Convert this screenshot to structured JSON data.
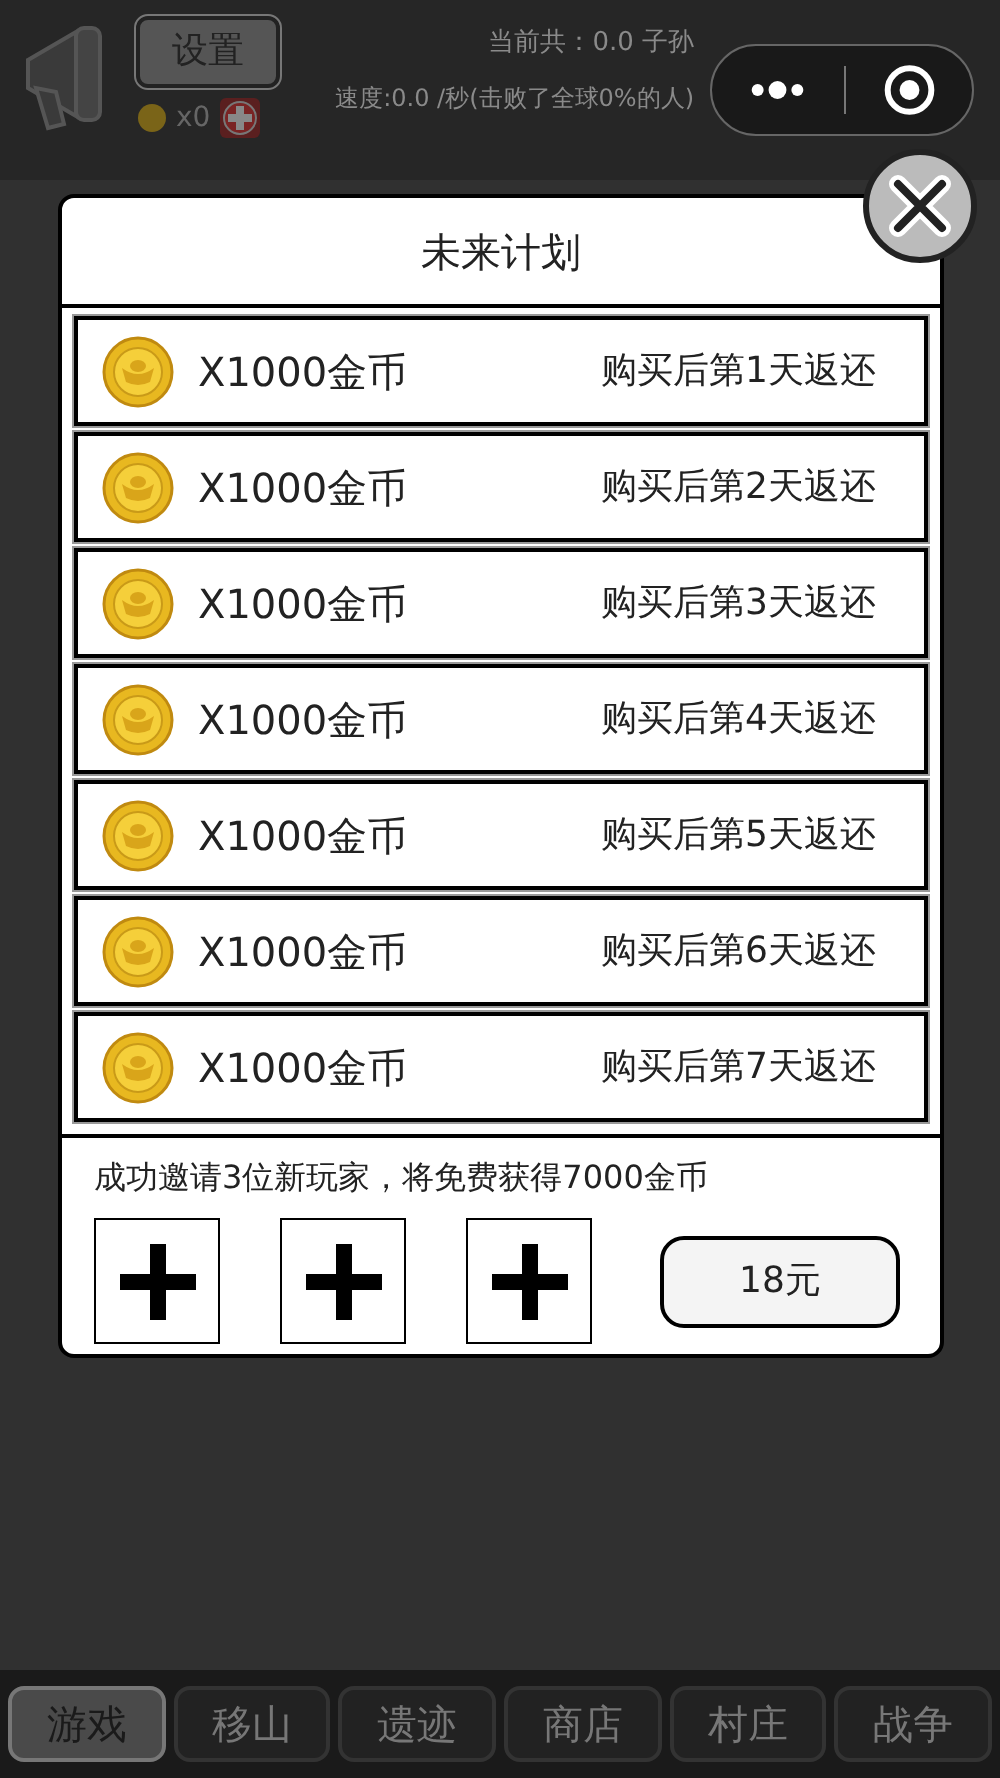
{
  "header": {
    "settings_button": "设置",
    "coins": "x0",
    "total": "当前共：0.0 子孙",
    "speed": "速度:0.0 /秒(击败了全球0%的人)"
  },
  "modal": {
    "title": "未来计划",
    "rewards": [
      {
        "amount": "X1000金币",
        "note": "购买后第1天返还"
      },
      {
        "amount": "X1000金币",
        "note": "购买后第2天返还"
      },
      {
        "amount": "X1000金币",
        "note": "购买后第3天返还"
      },
      {
        "amount": "X1000金币",
        "note": "购买后第4天返还"
      },
      {
        "amount": "X1000金币",
        "note": "购买后第5天返还"
      },
      {
        "amount": "X1000金币",
        "note": "购买后第6天返还"
      },
      {
        "amount": "X1000金币",
        "note": "购买后第7天返还"
      }
    ],
    "invite_text": "成功邀请3位新玩家，将免费获得7000金币",
    "price_button": "18元"
  },
  "tabs": [
    {
      "label": "游戏",
      "selected": true
    },
    {
      "label": "移山",
      "selected": false
    },
    {
      "label": "遗迹",
      "selected": false
    },
    {
      "label": "商店",
      "selected": false
    },
    {
      "label": "村庄",
      "selected": false
    },
    {
      "label": "战争",
      "selected": false
    }
  ]
}
